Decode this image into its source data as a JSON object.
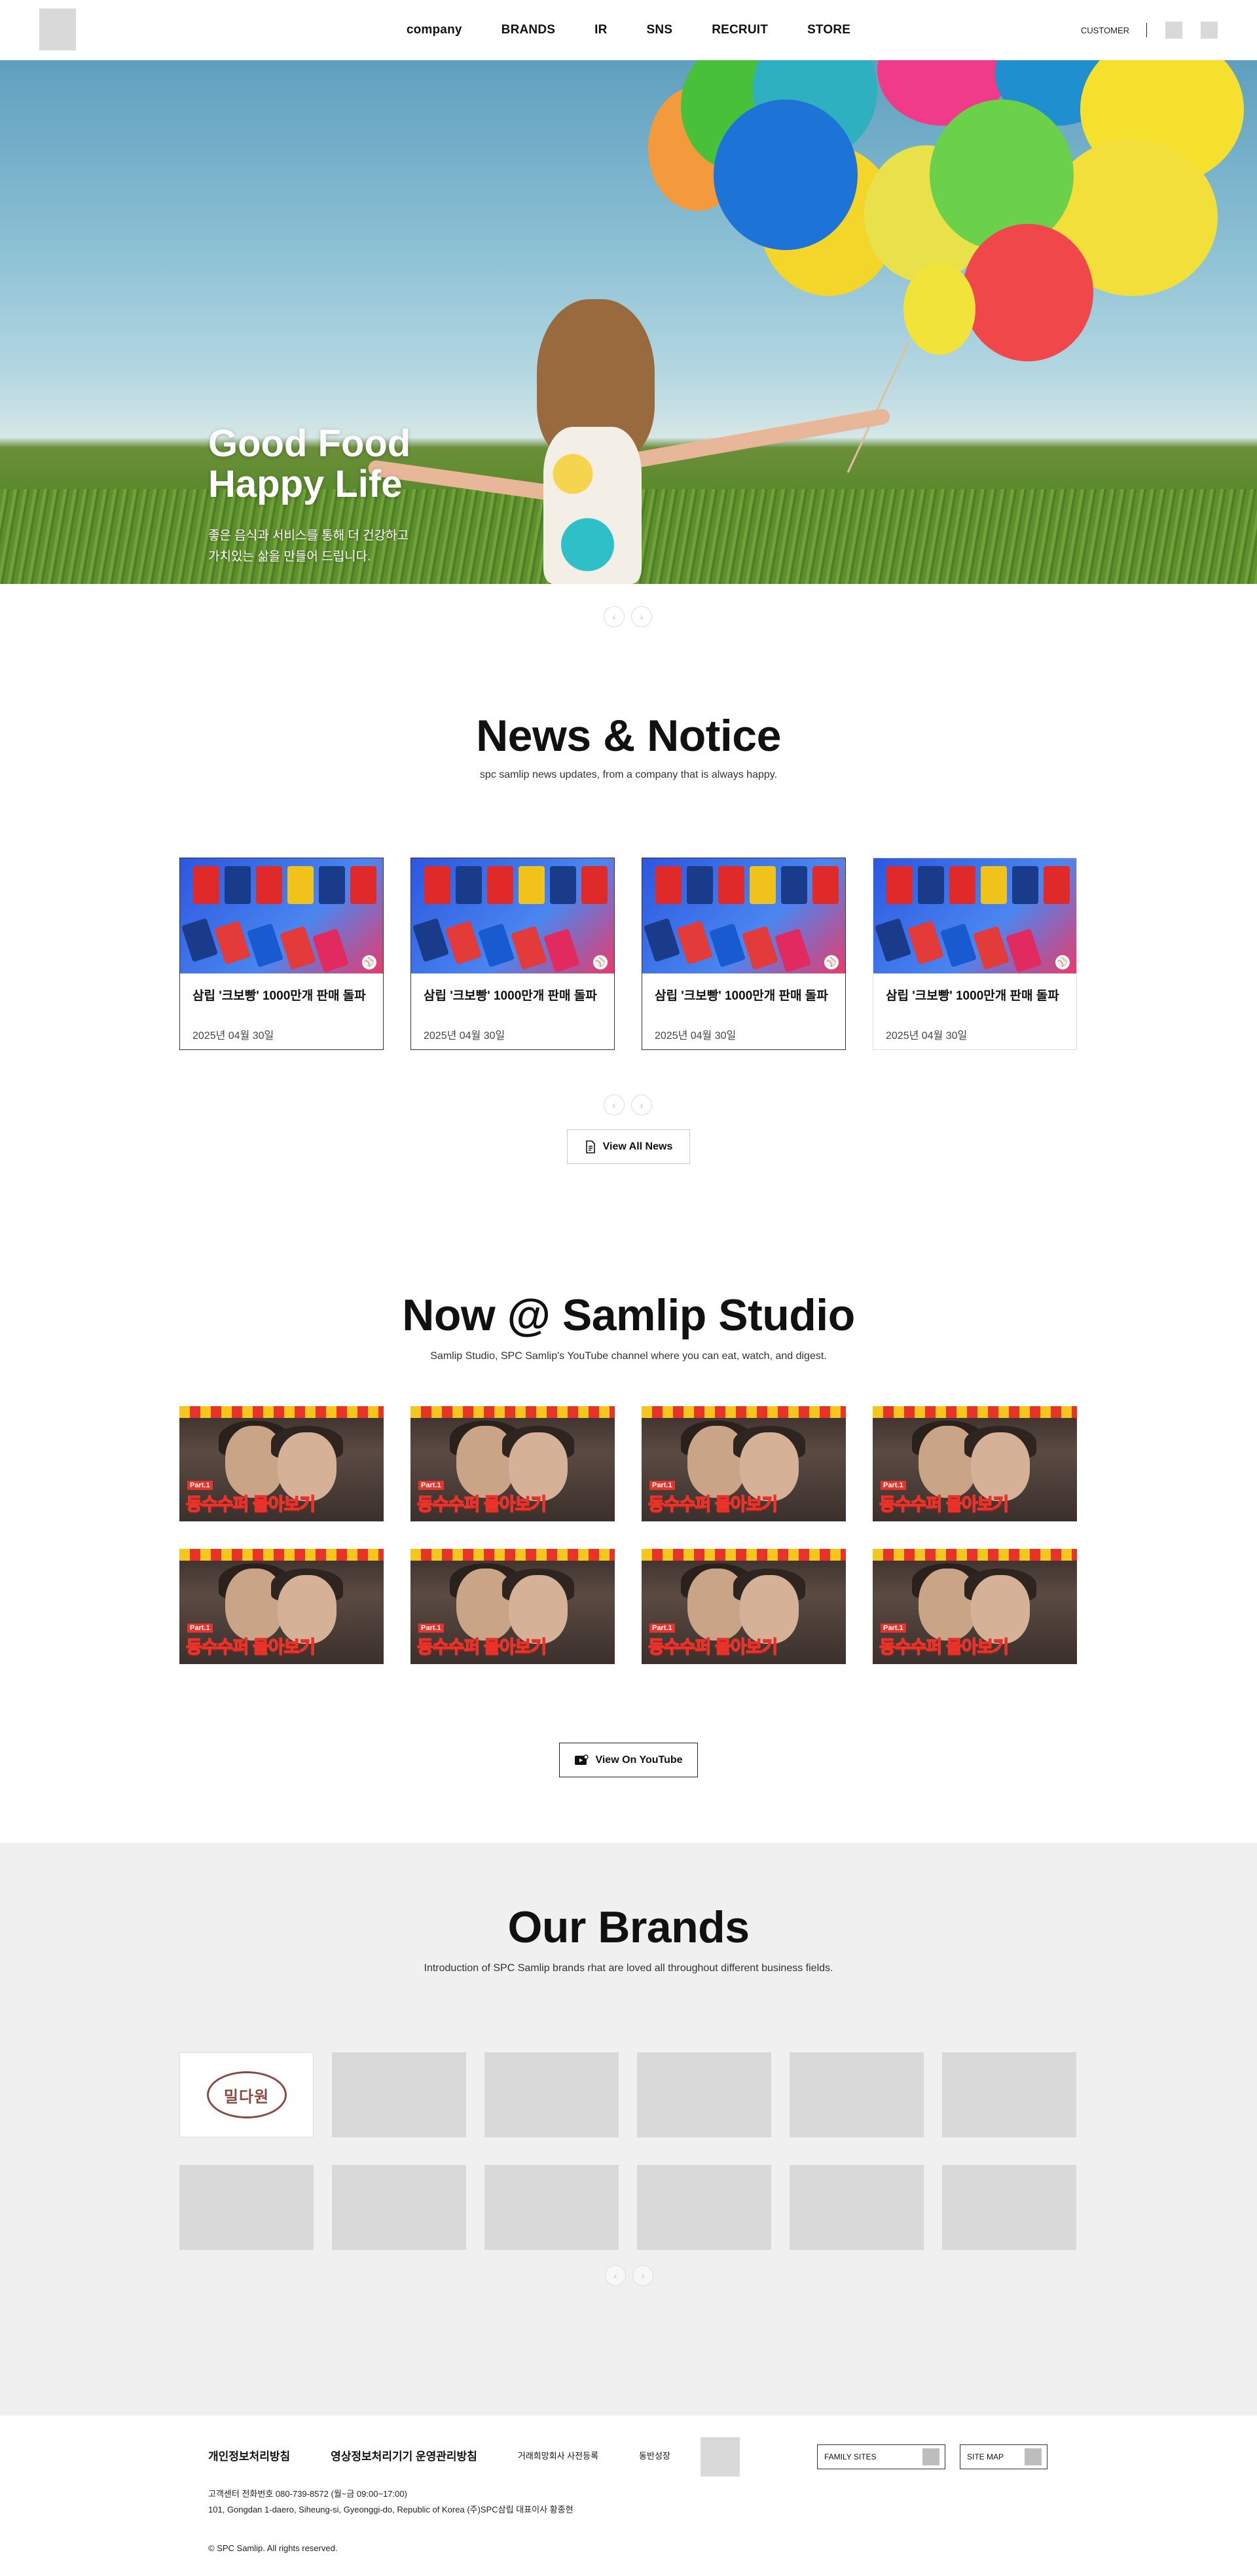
{
  "header": {
    "nav": [
      "company",
      "BRANDS",
      "IR",
      "SNS",
      "RECRUIT",
      "STORE"
    ],
    "customer_label": "CUSTOMER"
  },
  "hero": {
    "title": "Good Food\nHappy Life",
    "description": "좋은 음식과 서비스를 통해 더 건강하고\n가치있는 삶을 만들어 드립니다."
  },
  "news": {
    "title": "News & Notice",
    "subtitle": "spc samlip news updates, from a company that is always happy.",
    "items": [
      {
        "title": "삼립 '크보빵' 1000만개 판매 돌파",
        "date": "2025년 04월 30일"
      },
      {
        "title": "삼립 '크보빵' 1000만개 판매 돌파",
        "date": "2025년 04월 30일"
      },
      {
        "title": "삼립 '크보빵' 1000만개 판매 돌파",
        "date": "2025년 04월 30일"
      },
      {
        "title": "삼립 '크보빵' 1000만개 판매 돌파",
        "date": "2025년 04월 30일"
      }
    ],
    "view_all_label": "View All News"
  },
  "studio": {
    "title": "Now @ Samlip Studio",
    "subtitle": "Samlip Studio, SPC Samlip's YouTube channel where you can eat, watch, and digest.",
    "videos": [
      {
        "part": "Part.1",
        "caption": "동수수퍼 몰아보기"
      },
      {
        "part": "Part.1",
        "caption": "동수수퍼 몰아보기"
      },
      {
        "part": "Part.1",
        "caption": "동수수퍼 몰아보기"
      },
      {
        "part": "Part.1",
        "caption": "동수수퍼 몰아보기"
      },
      {
        "part": "Part.1",
        "caption": "동수수퍼 몰아보기"
      },
      {
        "part": "Part.1",
        "caption": "동수수퍼 몰아보기"
      },
      {
        "part": "Part.1",
        "caption": "동수수퍼 몰아보기"
      },
      {
        "part": "Part.1",
        "caption": "동수수퍼 몰아보기"
      }
    ],
    "youtube_label": "View On YouTube"
  },
  "brands": {
    "title": "Our Brands",
    "subtitle": "Introduction of SPC Samlip brands rhat are loved all throughout different business fields.",
    "first_logo_text": "밀다원"
  },
  "footer": {
    "links": [
      "개인정보처리방침",
      "영상정보처리기기 운영관리방침",
      "거래희망회사 사전등록",
      "동반성장"
    ],
    "family_sites": "FAMILY SITES",
    "site_map": "SITE MAP",
    "contact": "고객센터  전화번호 080-739-8572 (월~금 09:00~17:00)",
    "address": "101, Gongdan 1-daero, Siheung-si, Gyeonggi-do, Republic of Korea (주)SPC삼립 대표이사 황종현",
    "copyright": "© SPC Samlip. All rights reserved."
  },
  "colors": {
    "brand_bg": "#f0f0f0",
    "placeholder": "#d9d9d9",
    "text": "#111111"
  }
}
